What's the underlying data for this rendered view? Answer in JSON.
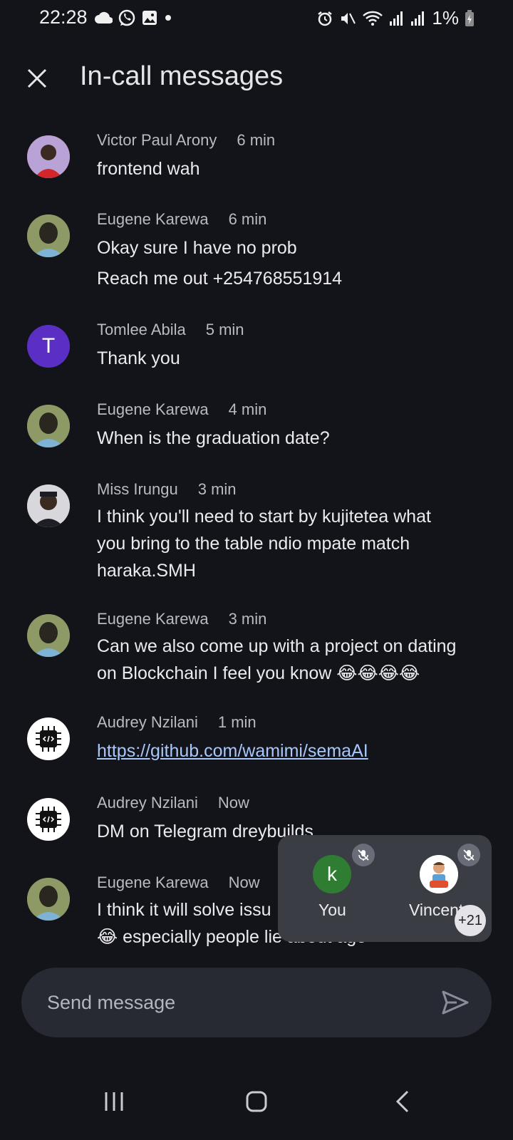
{
  "status_bar": {
    "time": "22:28",
    "battery": "1%",
    "left_icons": [
      "cloud-icon",
      "whatsapp-icon",
      "gallery-icon",
      "dot-icon"
    ],
    "right_icons": [
      "alarm-icon",
      "mute-icon",
      "wifi-icon",
      "signal-icon",
      "signal-icon",
      "battery-icon"
    ]
  },
  "header": {
    "title": "In-call messages",
    "close_icon": "close-icon"
  },
  "messages": [
    {
      "sender": "Victor Paul Arony",
      "time": "6 min",
      "lines": [
        "frontend wah"
      ]
    },
    {
      "sender": "Eugene Karewa",
      "time": "6 min",
      "lines": [
        "Okay sure I have no prob",
        "Reach me out +254768551914"
      ]
    },
    {
      "sender": "Tomlee Abila",
      "time": "5 min",
      "avatar_letter": "T",
      "lines": [
        "Thank you"
      ]
    },
    {
      "sender": "Eugene Karewa",
      "time": "4 min",
      "lines": [
        "When is the graduation date?"
      ]
    },
    {
      "sender": "Miss Irungu",
      "time": "3 min",
      "lines": [
        "I think you'll need to start by kujitetea what",
        "you bring to the table ndio mpate match",
        "haraka.SMH"
      ]
    },
    {
      "sender": "Eugene Karewa",
      "time": "3 min",
      "lines": [
        "Can we also come up with a project on dating",
        "on Blockchain I feel you know 😂😂😂😂"
      ]
    },
    {
      "sender": "Audrey Nzilani",
      "time": "1 min",
      "link": "https://github.com/wamimi/semaAI"
    },
    {
      "sender": "Audrey Nzilani",
      "time": "Now",
      "lines": [
        "DM on Telegram dreybuilds"
      ]
    },
    {
      "sender": "Eugene Karewa",
      "time": "Now",
      "lines": [
        "I think it will solve issu",
        "😂 especially people lie about age"
      ]
    }
  ],
  "participants": {
    "self": {
      "name": "You",
      "initial": "k",
      "color": "#2e7d32"
    },
    "other": {
      "name": "Vincent"
    },
    "more_count": "+21"
  },
  "compose": {
    "placeholder": "Send message"
  },
  "colors": {
    "background": "#131419",
    "link": "#a8c7fa",
    "letter_avatar": "#5b2fc4"
  }
}
